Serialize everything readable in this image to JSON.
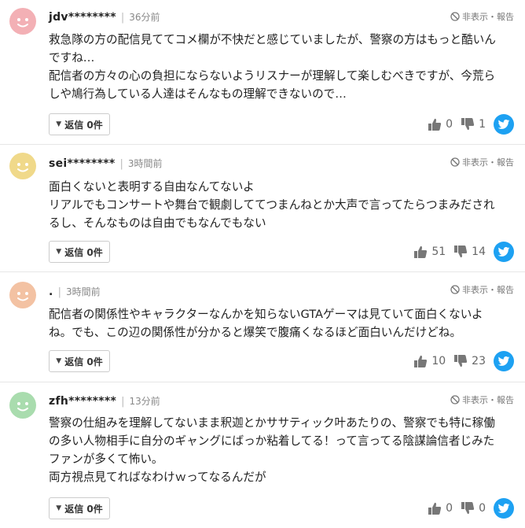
{
  "report_label": "非表示・報告",
  "comments": [
    {
      "user": "jdv********",
      "time": "36分前",
      "avatar_color": "#f3b0b5",
      "lines": [
        "救急隊の方の配信見ててコメ欄が不快だと感じていましたが、警察の方はもっと酷いん",
        "ですね…",
        "配信者の方々の心の負担にならないようリスナーが理解して楽しむべきですが、今荒ら",
        "しや鳩行為している人達はそんなもの理解できないので…"
      ],
      "reply_label": "返信 0件",
      "likes": "0",
      "dislikes": "1"
    },
    {
      "user": "sei********",
      "time": "3時間前",
      "avatar_color": "#f0d98a",
      "lines": [
        "面白くないと表明する自由なんてないよ",
        "リアルでもコンサートや舞台で観劇しててつまんねとか大声で言ってたらつまみだされ",
        "るし、そんなものは自由でもなんでもない"
      ],
      "reply_label": "返信 0件",
      "likes": "51",
      "dislikes": "14"
    },
    {
      "user": ".",
      "time": "3時間前",
      "avatar_color": "#f3c2a3",
      "lines": [
        "配信者の関係性やキャラクターなんかを知らないGTAゲーマは見ていて面白くないよ",
        "ね。でも、この辺の関係性が分かると爆笑で腹痛くなるほど面白いんだけどね。"
      ],
      "reply_label": "返信 0件",
      "likes": "10",
      "dislikes": "23"
    },
    {
      "user": "zfh********",
      "time": "13分前",
      "avatar_color": "#a9dcae",
      "lines": [
        "警察の仕組みを理解してないまま釈迦とかササティック叶あたりの、警察でも特に稼働",
        "の多い人物相手に自分のギャングにばっか粘着してる！って言ってる陰謀論信者じみた",
        "ファンが多くて怖い。",
        "両方視点見てればなわけｗってなるんだが"
      ],
      "reply_label": "返信 0件",
      "likes": "0",
      "dislikes": "0"
    }
  ]
}
